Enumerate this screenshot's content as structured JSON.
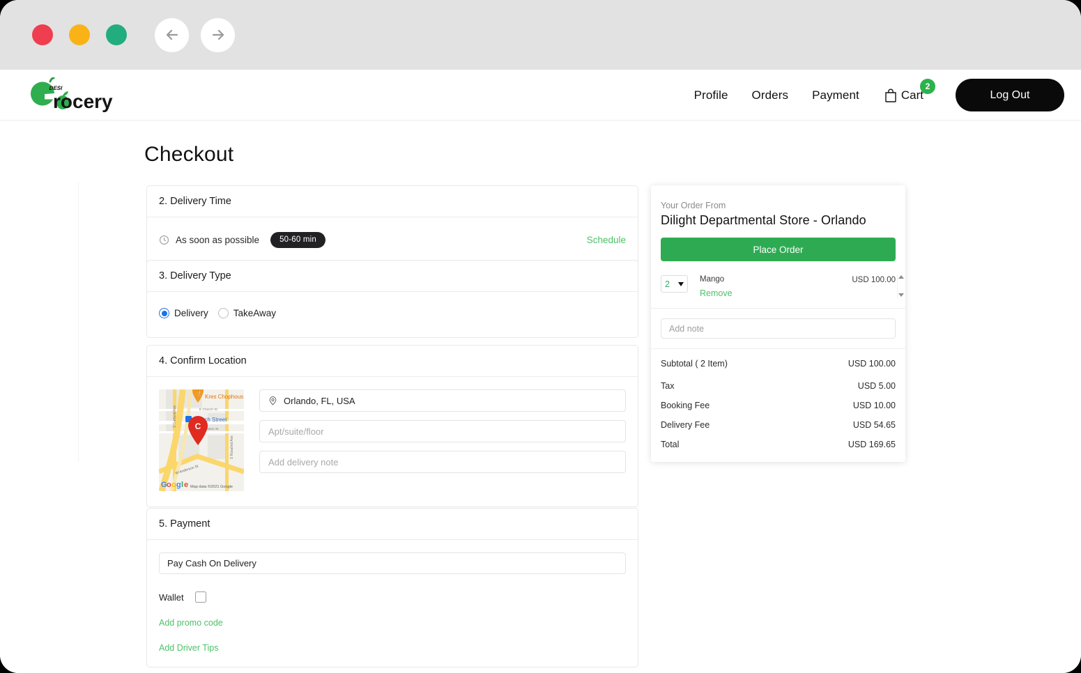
{
  "chrome": {
    "dots": [
      "close-red",
      "minimize-yellow",
      "maximize-green"
    ],
    "back_icon": "arrow-left-icon",
    "forward_icon": "arrow-right-icon"
  },
  "header": {
    "logo_text": "Grocery",
    "logo_badge": "DESI",
    "nav": [
      {
        "label": "Profile"
      },
      {
        "label": "Orders"
      },
      {
        "label": "Payment"
      }
    ],
    "cart": {
      "label": "Cart",
      "count": "2",
      "icon": "shopping-bag-icon"
    },
    "logout_label": "Log Out"
  },
  "page": {
    "title": "Checkout"
  },
  "delivery_time": {
    "heading": "2. Delivery Time",
    "option_label": "As soon as possible",
    "eta_badge": "50-60 min",
    "schedule_link": "Schedule",
    "icon": "clock-icon"
  },
  "delivery_type": {
    "heading": "3. Delivery Type",
    "options": [
      {
        "label": "Delivery",
        "selected": true
      },
      {
        "label": "TakeAway",
        "selected": false
      }
    ]
  },
  "confirm_location": {
    "heading": "4. Confirm Location",
    "address_value": "Orlando, FL, USA",
    "address_icon": "map-pin-icon",
    "apt_placeholder": "Apt/suite/floor",
    "apt_value": "",
    "note_placeholder": "Add delivery note",
    "note_value": "",
    "map": {
      "attribution": "Map data ©2021 Google",
      "provider": "Google",
      "marker_letter": "C",
      "poi": "Kres Chophouse",
      "streets": [
        "S Garland Ave",
        "E Church St",
        "Church Street",
        "S Rosalind Ave",
        "Jackson St",
        "W Anderson St"
      ]
    }
  },
  "payment": {
    "heading": "5. Payment",
    "method_value": "Pay Cash On Delivery",
    "wallet_label": "Wallet",
    "wallet_checked": false,
    "promo_link": "Add promo code",
    "tips_link": "Add Driver Tips"
  },
  "order_summary": {
    "from_label": "Your Order From",
    "store_name": "Dilight Departmental Store - Orlando",
    "place_order_label": "Place Order",
    "items": [
      {
        "qty": "2",
        "name": "Mango",
        "price": "USD 100.00",
        "remove_label": "Remove"
      }
    ],
    "note_placeholder": "Add note",
    "note_value": "",
    "totals": [
      {
        "label": "Subtotal ( 2 Item)",
        "value": "USD 100.00"
      },
      {
        "label": "Tax",
        "value": "USD 5.00"
      },
      {
        "label": "Booking Fee",
        "value": "USD 10.00"
      },
      {
        "label": "Delivery Fee",
        "value": "USD 54.65"
      },
      {
        "label": "Total",
        "value": "USD 169.65"
      }
    ]
  },
  "colors": {
    "brand_green": "#2bb24c",
    "link_green": "#4dc169",
    "place_order_green": "#2eab52",
    "radio_blue": "#1a73e8",
    "dark": "#0a0a0a"
  }
}
